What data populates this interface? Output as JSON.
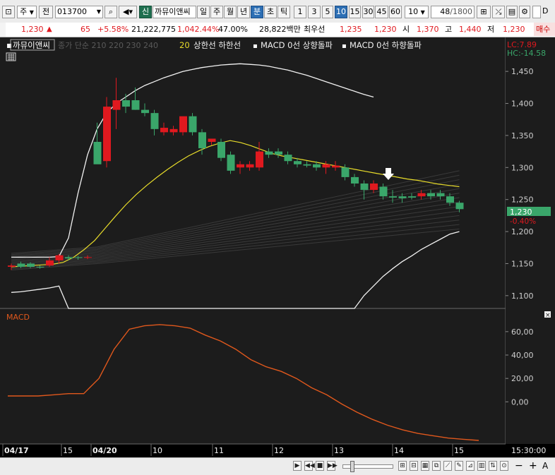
{
  "toolbar": {
    "market": "주",
    "prev_label": "전",
    "code": "013700",
    "new_badge": "신",
    "stock_name": "까뮤이앤씨",
    "periods": [
      "일",
      "주",
      "월",
      "년",
      "분",
      "초",
      "틱"
    ],
    "active_period": "분",
    "intervals": [
      "1",
      "3",
      "5",
      "10",
      "15",
      "30",
      "45",
      "60"
    ],
    "active_interval": "10",
    "interval_value": "10",
    "count": "48",
    "count_total": "/1800",
    "d_label": "D"
  },
  "quote": {
    "price": "1,230",
    "arrow": "▲",
    "change": "65",
    "change_pct": "+5.58%",
    "volume": "21,222,775",
    "volume_ratio": "1,042.44%",
    "turnover": "47.00%",
    "amount": "28,822백만",
    "best_ask_label": "최우선",
    "best_ask": "1,235",
    "best_bid": "1,230",
    "open_label": "시",
    "open": "1,370",
    "high_label": "고",
    "high": "1,440",
    "low_label": "저",
    "low": "1,230",
    "buy_label": "매수"
  },
  "legend": {
    "stock": "까뮤이앤씨",
    "ma_faint": "종가 단순 210 220 230 240",
    "ma20": "20",
    "limit": "상한선 하한선",
    "macd_up": "MACD 0선 상향돌파",
    "macd_down": "MACD 0선 하향돌파",
    "lc": "LC:7.89",
    "hc": "HC:-14.58",
    "last_price": "1,230",
    "last_pct": "-0.40%"
  },
  "macd_panel": {
    "title": "MACD",
    "close": "×"
  },
  "colors": {
    "up": "#e0191f",
    "down": "#3aa66a",
    "ma20": "#e8dc2a",
    "band": "#f2f2f2",
    "macd": "#e0581c",
    "bg": "#1c1c1c",
    "price_tag": "#3aa66a"
  },
  "chart_data": [
    {
      "type": "candlestick",
      "title": "",
      "x_ticks": [
        "04/17",
        "15",
        "04/20",
        "10",
        "11",
        "12",
        "13",
        "14",
        "15",
        "15:30:00"
      ],
      "y_ticks": [
        "1,450",
        "1,400",
        "1,350",
        "1,300",
        "1,250",
        "1,200",
        "1,150",
        "1,100"
      ],
      "ylim": [
        1080,
        1470
      ],
      "bars": [
        {
          "o": 1145,
          "h": 1150,
          "l": 1140,
          "c": 1147
        },
        {
          "o": 1150,
          "h": 1153,
          "l": 1143,
          "c": 1145
        },
        {
          "o": 1150,
          "h": 1152,
          "l": 1143,
          "c": 1145
        },
        {
          "o": 1145,
          "h": 1147,
          "l": 1142,
          "c": 1144
        },
        {
          "o": 1147,
          "h": 1160,
          "l": 1145,
          "c": 1155
        },
        {
          "o": 1155,
          "h": 1165,
          "l": 1150,
          "c": 1163
        },
        {
          "o": 1160,
          "h": 1163,
          "l": 1155,
          "c": 1158
        },
        {
          "o": 1160,
          "h": 1162,
          "l": 1156,
          "c": 1159
        },
        {
          "o": 1160,
          "h": 1163,
          "l": 1157,
          "c": 1160
        },
        {
          "o": 1340,
          "h": 1370,
          "l": 1325,
          "c": 1305
        },
        {
          "o": 1310,
          "h": 1410,
          "l": 1300,
          "c": 1395
        },
        {
          "o": 1390,
          "h": 1440,
          "l": 1360,
          "c": 1405
        },
        {
          "o": 1405,
          "h": 1415,
          "l": 1385,
          "c": 1395
        },
        {
          "o": 1405,
          "h": 1425,
          "l": 1390,
          "c": 1390
        },
        {
          "o": 1390,
          "h": 1400,
          "l": 1380,
          "c": 1385
        },
        {
          "o": 1385,
          "h": 1390,
          "l": 1350,
          "c": 1360
        },
        {
          "o": 1355,
          "h": 1370,
          "l": 1350,
          "c": 1362
        },
        {
          "o": 1355,
          "h": 1365,
          "l": 1350,
          "c": 1360
        },
        {
          "o": 1355,
          "h": 1370,
          "l": 1350,
          "c": 1380
        },
        {
          "o": 1380,
          "h": 1385,
          "l": 1350,
          "c": 1355
        },
        {
          "o": 1355,
          "h": 1360,
          "l": 1320,
          "c": 1330
        },
        {
          "o": 1340,
          "h": 1345,
          "l": 1335,
          "c": 1345
        },
        {
          "o": 1340,
          "h": 1345,
          "l": 1310,
          "c": 1315
        },
        {
          "o": 1320,
          "h": 1325,
          "l": 1290,
          "c": 1295
        },
        {
          "o": 1300,
          "h": 1310,
          "l": 1290,
          "c": 1305
        },
        {
          "o": 1300,
          "h": 1310,
          "l": 1295,
          "c": 1305
        },
        {
          "o": 1300,
          "h": 1340,
          "l": 1295,
          "c": 1325
        },
        {
          "o": 1325,
          "h": 1330,
          "l": 1315,
          "c": 1320
        },
        {
          "o": 1325,
          "h": 1330,
          "l": 1315,
          "c": 1320
        },
        {
          "o": 1320,
          "h": 1325,
          "l": 1305,
          "c": 1310
        },
        {
          "o": 1310,
          "h": 1315,
          "l": 1300,
          "c": 1305
        },
        {
          "o": 1305,
          "h": 1310,
          "l": 1300,
          "c": 1303
        },
        {
          "o": 1305,
          "h": 1310,
          "l": 1295,
          "c": 1300
        },
        {
          "o": 1300,
          "h": 1310,
          "l": 1290,
          "c": 1305
        },
        {
          "o": 1300,
          "h": 1310,
          "l": 1295,
          "c": 1303
        },
        {
          "o": 1300,
          "h": 1305,
          "l": 1280,
          "c": 1285
        },
        {
          "o": 1285,
          "h": 1290,
          "l": 1270,
          "c": 1275
        },
        {
          "o": 1275,
          "h": 1280,
          "l": 1250,
          "c": 1265
        },
        {
          "o": 1265,
          "h": 1280,
          "l": 1260,
          "c": 1275
        },
        {
          "o": 1270,
          "h": 1275,
          "l": 1250,
          "c": 1255
        },
        {
          "o": 1255,
          "h": 1265,
          "l": 1245,
          "c": 1253
        },
        {
          "o": 1255,
          "h": 1260,
          "l": 1245,
          "c": 1252
        },
        {
          "o": 1255,
          "h": 1260,
          "l": 1250,
          "c": 1253
        },
        {
          "o": 1255,
          "h": 1265,
          "l": 1250,
          "c": 1260
        },
        {
          "o": 1260,
          "h": 1265,
          "l": 1250,
          "c": 1255
        },
        {
          "o": 1260,
          "h": 1265,
          "l": 1250,
          "c": 1255
        },
        {
          "o": 1255,
          "h": 1260,
          "l": 1240,
          "c": 1245
        },
        {
          "o": 1245,
          "h": 1248,
          "l": 1230,
          "c": 1235
        }
      ],
      "series": [
        {
          "name": "20",
          "values": [
            1145,
            1146,
            1147,
            1148,
            1149,
            1152,
            1160,
            1172,
            1186,
            1205,
            1224,
            1242,
            1258,
            1272,
            1285,
            1297,
            1308,
            1318,
            1326,
            1333,
            1338,
            1342,
            1339,
            1334,
            1328,
            1322,
            1318,
            1315,
            1312,
            1309,
            1306,
            1303,
            1300,
            1297,
            1294,
            1291,
            1288,
            1285,
            1282,
            1280,
            1277,
            1274,
            1272,
            1270
          ]
        },
        {
          "name": "상한선",
          "values": [
            1160,
            1160,
            1160,
            1160,
            1160,
            1161,
            1190,
            1260,
            1320,
            1360,
            1385,
            1400,
            1410,
            1420,
            1428,
            1434,
            1440,
            1445,
            1450,
            1453,
            1456,
            1458,
            1460,
            1461,
            1462,
            1461,
            1460,
            1458,
            1455,
            1452,
            1448,
            1444,
            1439,
            1434,
            1429,
            1424,
            1419,
            1414,
            1410
          ]
        },
        {
          "name": "하한선",
          "values": [
            1105,
            1106,
            1108,
            1110,
            1112,
            1115,
            1080,
            1000,
            960,
            960,
            960,
            960,
            960,
            960,
            960,
            960,
            960,
            960,
            960,
            960,
            1020,
            1040,
            1060,
            1080,
            1100,
            1115,
            1130,
            1142,
            1153,
            1162,
            1172,
            1180,
            1188,
            1196,
            1200
          ]
        },
        {
          "name": "MACD",
          "values": [
            5,
            5,
            5,
            6,
            7,
            7,
            20,
            45,
            62,
            65,
            66,
            65,
            63,
            57,
            52,
            45,
            36,
            30,
            26,
            20,
            12,
            6,
            -2,
            -9,
            -15,
            -20,
            -24,
            -27,
            -29,
            -31,
            -32,
            -33
          ]
        }
      ],
      "macd_ticks": [
        "60,00",
        "40,00",
        "20,00",
        "0,00"
      ],
      "macd_ylim": [
        -36,
        75
      ]
    }
  ]
}
